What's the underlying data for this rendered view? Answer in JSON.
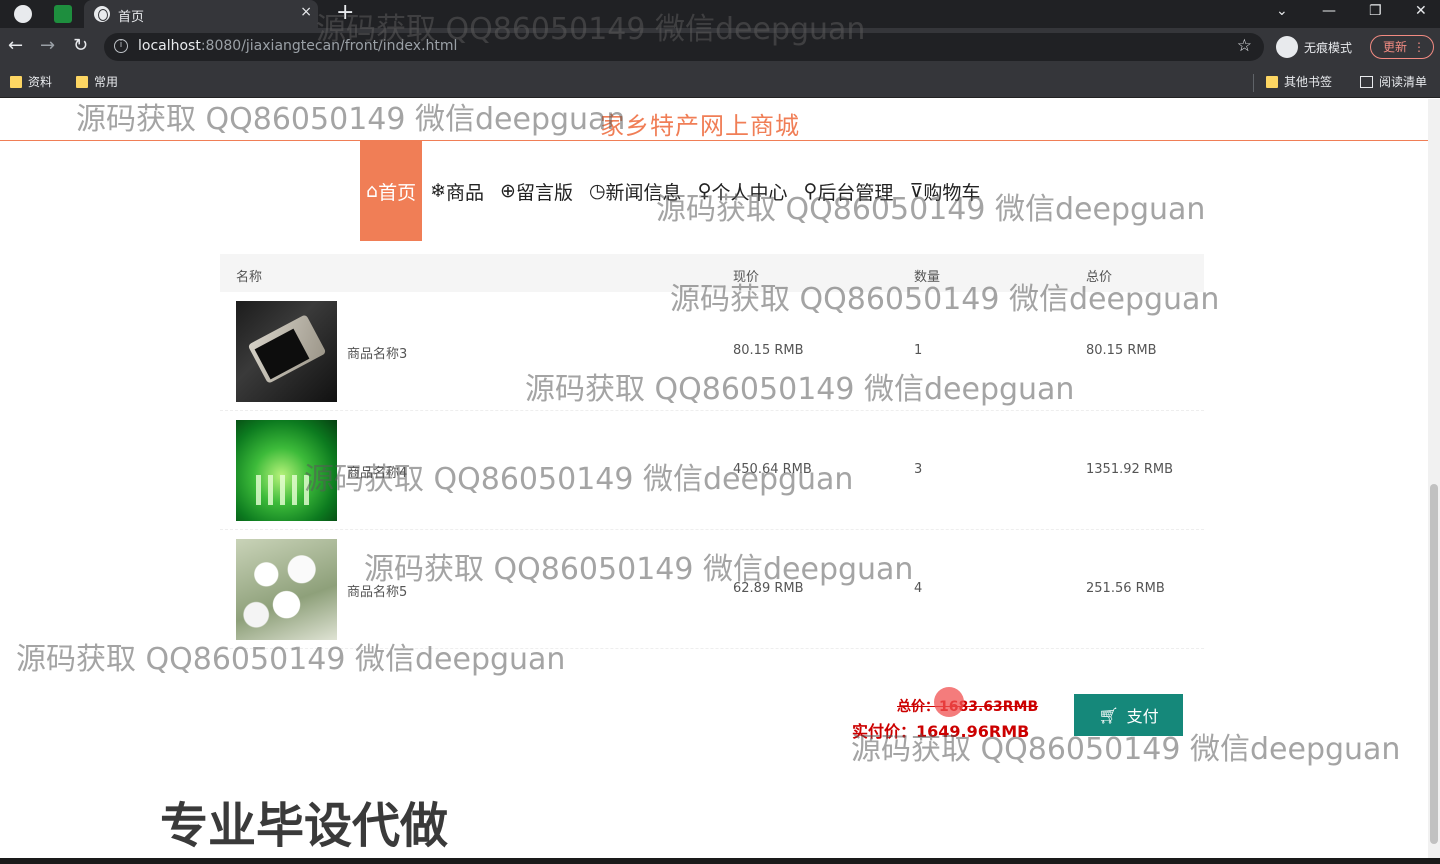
{
  "browser": {
    "tab_title": "首页",
    "tab_close": "×",
    "new_tab": "+",
    "url_host": "localhost",
    "url_rest": ":8080/jiaxiangtecan/front/index.html",
    "incognito_label": "无痕模式",
    "update_label": "更新",
    "update_more": "⋮",
    "bookmarks": [
      "资料",
      "常用"
    ],
    "other_bookmarks": "其他书签",
    "reading_list": "阅读清单"
  },
  "site": {
    "title": "家乡特产网上商城"
  },
  "menu": [
    {
      "icon": "⌂",
      "label": "首页",
      "active": true
    },
    {
      "icon": "❄",
      "label": "商品"
    },
    {
      "icon": "⊕",
      "label": "留言版"
    },
    {
      "icon": "◷",
      "label": "新闻信息"
    },
    {
      "icon": "♀",
      "label": "个人中心"
    },
    {
      "icon": "⚲",
      "label": "后台管理"
    },
    {
      "icon": "⊽",
      "label": "购物车"
    }
  ],
  "cart": {
    "headers": {
      "name": "名称",
      "price": "现价",
      "qty": "数量",
      "total": "总价"
    },
    "rows": [
      {
        "name": "商品名称3",
        "price": "80.15 RMB",
        "qty": "1",
        "total": "80.15 RMB"
      },
      {
        "name": "商品名称4",
        "price": "450.64 RMB",
        "qty": "3",
        "total": "1351.92 RMB"
      },
      {
        "name": "商品名称5",
        "price": "62.89 RMB",
        "qty": "4",
        "total": "251.56 RMB"
      }
    ],
    "total_original": "总价：1683.63RMB",
    "total_actual": "实付价：1649.96RMB",
    "pay_label": "支付"
  },
  "watermarks": [
    "源码获取 QQ86050149 微信deepguan"
  ],
  "promo": "专业毕设代做",
  "colors": {
    "accent": "#f07e56",
    "pay": "#15887a",
    "price_red": "#cc0000"
  }
}
